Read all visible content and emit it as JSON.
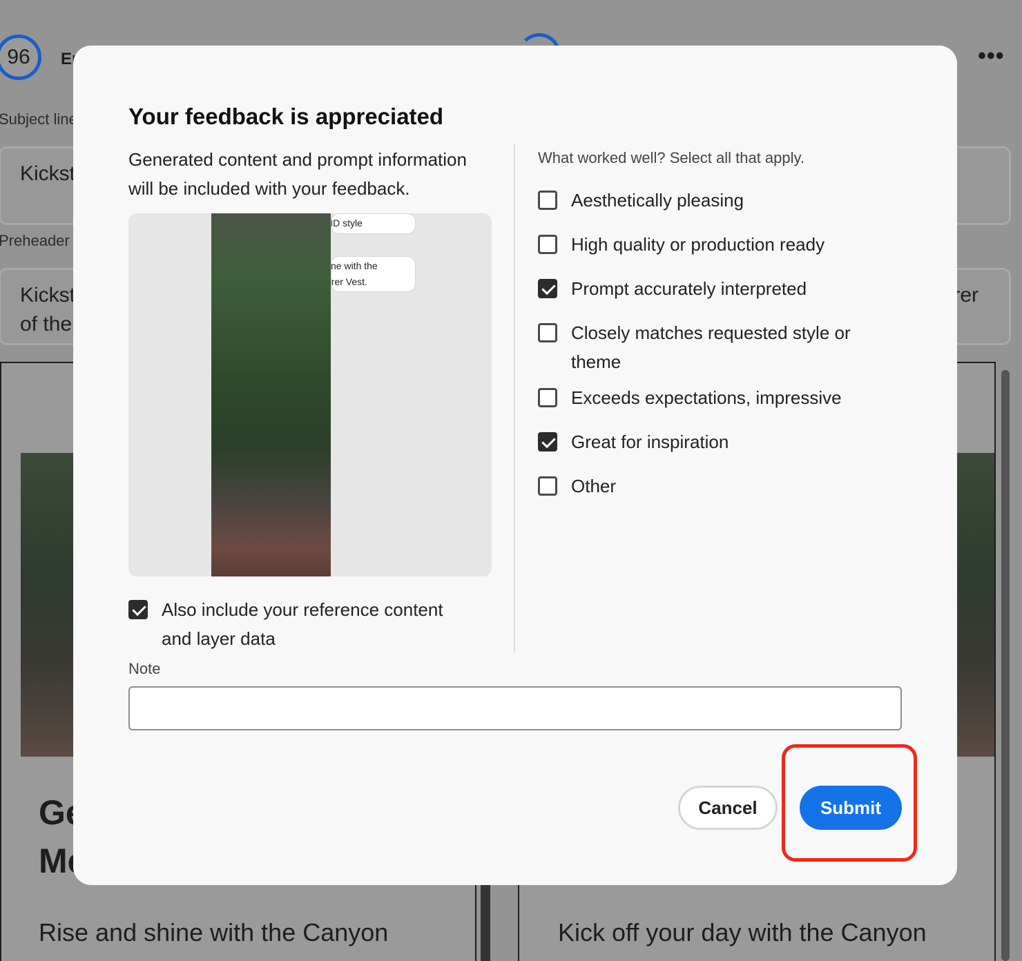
{
  "background": {
    "score": "96",
    "email_title": "Er",
    "subject_label": "Subject line",
    "subject_value": "Kickst",
    "preheader_label": "Preheader",
    "preheader_value_line1": "Kickst",
    "preheader_value_line2": "of the",
    "preheader_right_fragment": "rer",
    "card_heading_line1": "Ge",
    "card_heading_line2": "Mc",
    "card_left_body": "Rise and shine with the Canyon",
    "card_right_body": "Kick off your day with the Canyon",
    "more_label": "•••"
  },
  "modal": {
    "title": "Your feedback is appreciated",
    "description": "Generated content and prompt information will be included with your feedback.",
    "preview": {
      "bubble1": "ND style",
      "bubble2_line1": "tine with the",
      "bubble2_line2": "orer Vest."
    },
    "include_reference": {
      "label": "Also include your reference content and layer data",
      "checked": true
    },
    "right_prompt": "What worked well? Select all that apply.",
    "options": [
      {
        "label": "Aesthetically pleasing",
        "checked": false
      },
      {
        "label": "High quality or production ready",
        "checked": false
      },
      {
        "label": "Prompt accurately interpreted",
        "checked": true
      },
      {
        "label": "Closely matches requested style or theme",
        "checked": false
      },
      {
        "label": "Exceeds expectations, impressive",
        "checked": false
      },
      {
        "label": "Great for inspiration",
        "checked": true
      },
      {
        "label": "Other",
        "checked": false
      }
    ],
    "note_label": "Note",
    "note_value": "",
    "cancel_label": "Cancel",
    "submit_label": "Submit"
  },
  "colors": {
    "accent": "#1473e6",
    "highlight": "#f0271b",
    "overlay": "#949494"
  }
}
